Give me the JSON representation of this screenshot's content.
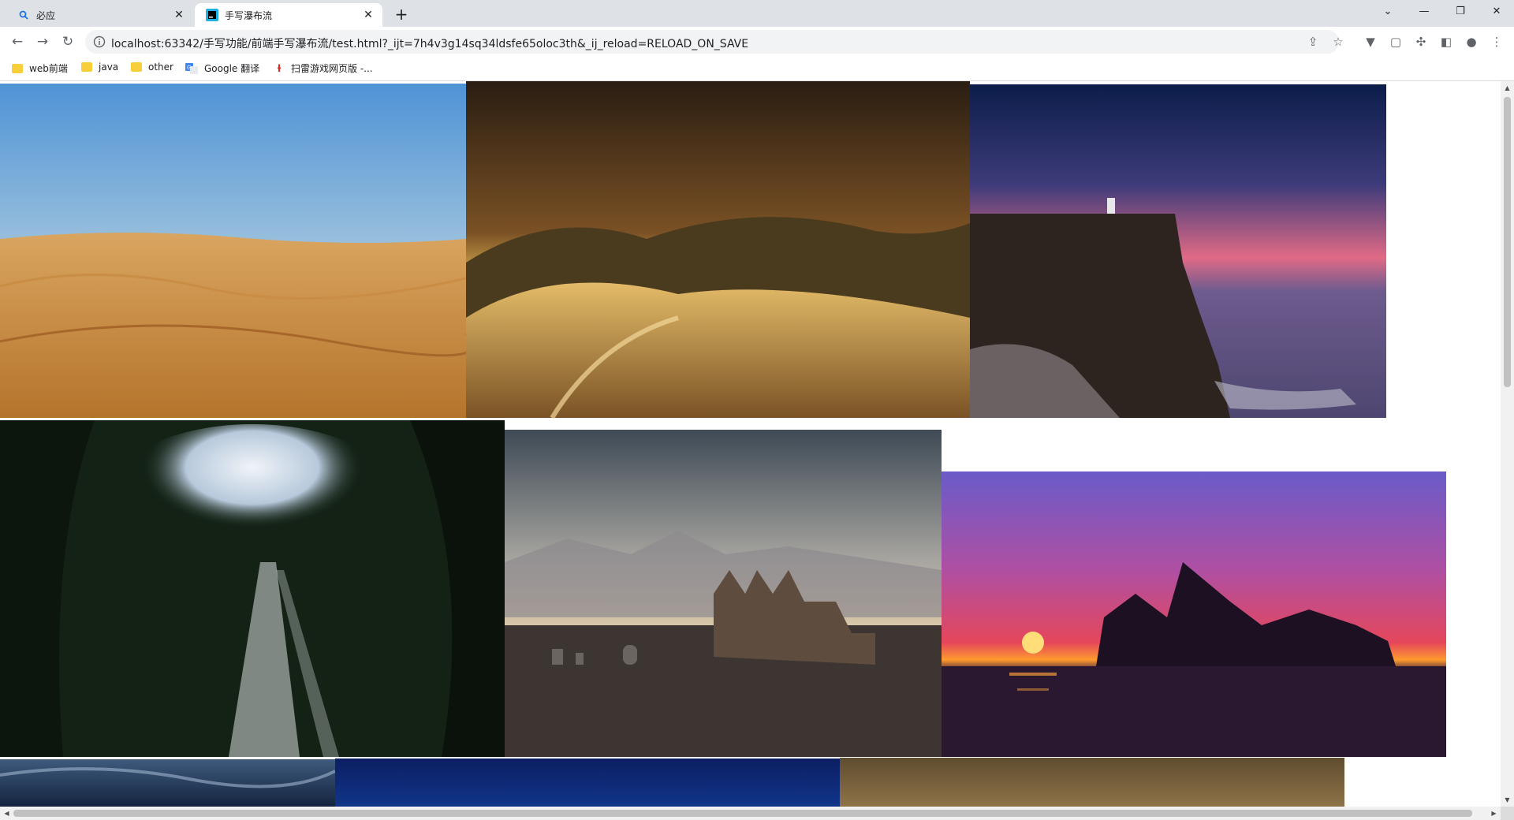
{
  "browser": {
    "tabs": [
      {
        "title": "必应",
        "icon": "search-icon"
      },
      {
        "title": "手写瀑布流",
        "icon": "webstorm-icon"
      }
    ],
    "new_tab": "+",
    "close_glyph": "✕",
    "window": {
      "dropdown": "⌄",
      "minimize": "—",
      "restore": "❐",
      "close": "✕"
    },
    "nav": {
      "back": "←",
      "forward": "→",
      "reload": "↻"
    },
    "url": "localhost:63342/手写功能/前端手写瀑布流/test.html?_ijt=7h4v3g14sq34ldsfe65oloc3th&_ij_reload=RELOAD_ON_SAVE",
    "omnibox_icons": {
      "share": "⇪",
      "star": "☆"
    },
    "extensions": {
      "vpn": "▼",
      "ext2": "▢",
      "puzzle": "✣",
      "sidepanel": "◧",
      "profile": "●",
      "menu": "⋮"
    },
    "bookmarks": [
      {
        "label": "web前端",
        "icon": "folder-icon"
      },
      {
        "label": "java",
        "icon": "folder-icon"
      },
      {
        "label": "other",
        "icon": "folder-icon"
      },
      {
        "label": "Google 翻译",
        "icon": "google-translate-icon"
      },
      {
        "label": "扫雷游戏网页版 -...",
        "icon": "minesweeper-icon"
      }
    ]
  },
  "gallery": {
    "images": [
      {
        "name": "desert-dunes-blue-sky",
        "description": "Sand dunes under a clear blue sky"
      },
      {
        "name": "sunset-sand-dunes",
        "description": "Golden sunset over grassy sand dunes"
      },
      {
        "name": "cliff-lighthouse-dusk",
        "description": "Sea cliff with lighthouse at dusk"
      },
      {
        "name": "cave-waterfall",
        "description": "Waterfall pouring through a cave opening"
      },
      {
        "name": "ruined-abbey-graveyard",
        "description": "Ruined gothic abbey with gravestones"
      },
      {
        "name": "opera-house-sunset",
        "description": "Sydney Opera House silhouette at sunset"
      },
      {
        "name": "night-sky-clouds",
        "description": "Dark sky with wispy clouds"
      },
      {
        "name": "deep-blue-sky",
        "description": "Deep blue night sky"
      },
      {
        "name": "golden-haze",
        "description": "Brownish golden sky"
      }
    ]
  },
  "scrollbar": {
    "up": "▲",
    "down": "▼",
    "left": "◀",
    "right": "▶"
  }
}
